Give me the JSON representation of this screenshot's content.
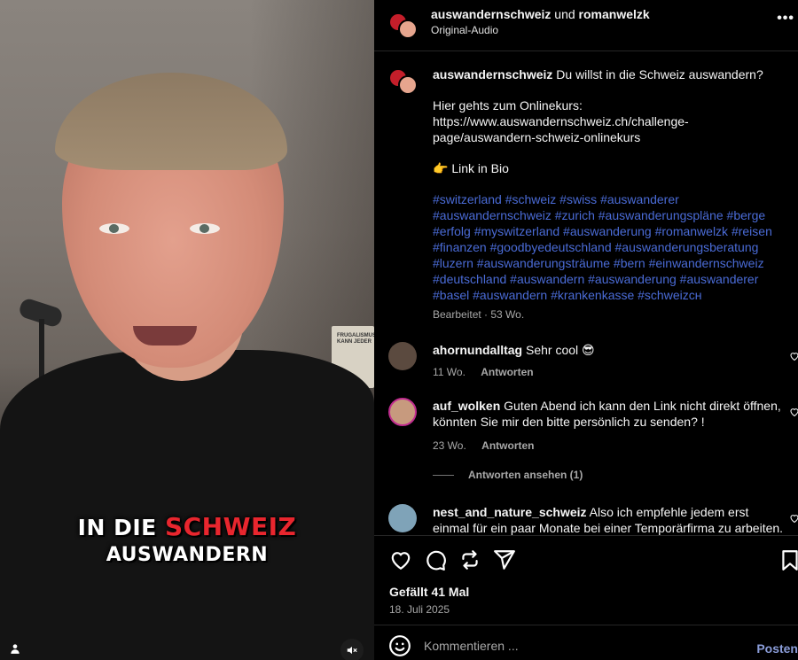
{
  "video": {
    "caption_line1_white": "IN DIE",
    "caption_line1_highlight": "SCHWEIZ",
    "caption_line2": "AUSWANDERN",
    "highlight_color": "#e8262e",
    "book_text": "FRUGALISMUS KANN JEDER"
  },
  "header": {
    "user1": "auswandernschweiz",
    "connector": "und",
    "user2": "romanwelzk",
    "audio": "Original-Audio",
    "more_icon": "•••"
  },
  "post": {
    "username": "auswandernschweiz",
    "intro": "Du willst in die Schweiz auswandern?",
    "course_text": "Hier gehts zum Onlinekurs:\nhttps://www.auswandernschweiz.ch/challenge-page/auswandern-schweiz-onlinekurs",
    "link_in_bio": "👉 Link in Bio",
    "hashtags": "#switzerland #schweiz #swiss #auswanderer #auswandernschweiz #zurich #auswanderungspläne #berge #erfolg #myswitzerland #auswanderung #romanwelzk #reisen #finanzen #goodbyedeutschland #auswanderungsberatung #luzern #auswanderungsträume #bern #einwandernschweiz #deutschland #auswandern #auswanderung #auswanderer #basel #auswandern #krankenkasse #schweizᴄʜ",
    "meta": "Bearbeitet · 53 Wo."
  },
  "comments": [
    {
      "username": "ahornundalltag",
      "text": "Sehr cool 😎",
      "age": "11 Wo.",
      "reply": "Antworten",
      "avatar_color": "#5b4a3f"
    },
    {
      "username": "auf_wolken",
      "text": "Guten Abend ich kann den Link nicht direkt öffnen, könnten Sie mir den bitte persönlich zu senden? !",
      "age": "23 Wo.",
      "reply": "Antworten",
      "avatar_color": "#c79a7e"
    },
    {
      "username": "nest_and_nature_schweiz",
      "text": "Also ich empfehle jedem erst einmal für ein paar Monate bei einer Temporärfirma zu arbeiten. Da",
      "avatar_color": "#7fa3b8"
    }
  ],
  "view_replies": "Antworten ansehen (1)",
  "actions": {
    "likes": "Gefällt 41 Mal",
    "date": "18. Juli 2025"
  },
  "composer": {
    "placeholder": "Kommentieren ...",
    "post_label": "Posten"
  }
}
